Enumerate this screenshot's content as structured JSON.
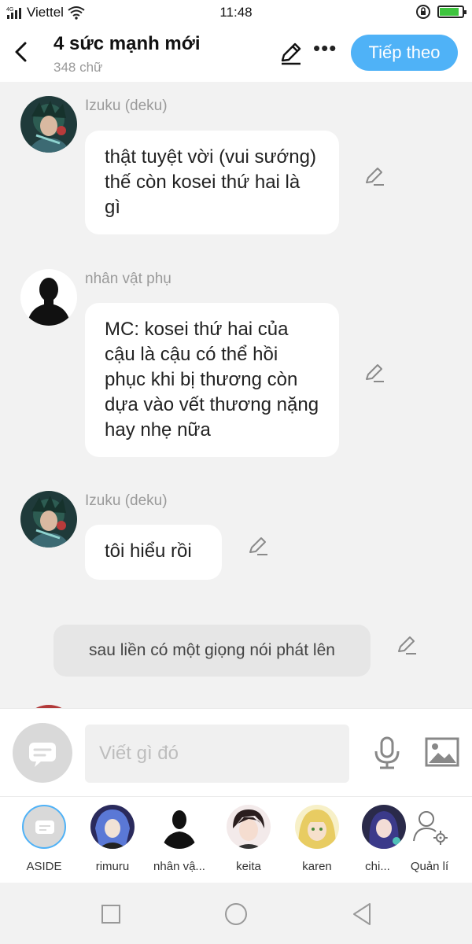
{
  "status_bar": {
    "network": "4G",
    "carrier": "Viettel",
    "time": "11:48",
    "battery_percent": 80,
    "battery_color": "#3ec43e"
  },
  "header": {
    "title": "4 sức mạnh mới",
    "word_count": "348 chữ",
    "next_label": "Tiếp theo",
    "accent": "#4fb2f7",
    "more_icon": "more-horizontal-icon",
    "edit_icon": "pen-icon"
  },
  "messages": [
    {
      "sender": "Izuku (deku)",
      "text": "thật tuyệt vời (vui sướng)  thế còn kosei thứ hai là gì"
    },
    {
      "sender": "nhân vật phụ",
      "text": "MC: kosei thứ hai của cậu là cậu có thể hồi phục khi bị thương còn dựa vào vết thương nặng hay nhẹ nữa"
    },
    {
      "sender": "Izuku (deku)",
      "text": "tôi hiểu rồi"
    }
  ],
  "aside_message": "sau liền có một giọng nói phát lên",
  "composer": {
    "placeholder": "Viết gì đó",
    "mic_icon": "microphone-icon",
    "image_icon": "image-icon"
  },
  "characters": [
    {
      "label": "ASIDE"
    },
    {
      "label": "rimuru"
    },
    {
      "label": "nhân vậ..."
    },
    {
      "label": "keita"
    },
    {
      "label": "karen"
    },
    {
      "label": "chi..."
    },
    {
      "label": "Quản lí"
    }
  ],
  "nav": [
    "square-icon",
    "circle-icon",
    "triangle-back-icon"
  ]
}
